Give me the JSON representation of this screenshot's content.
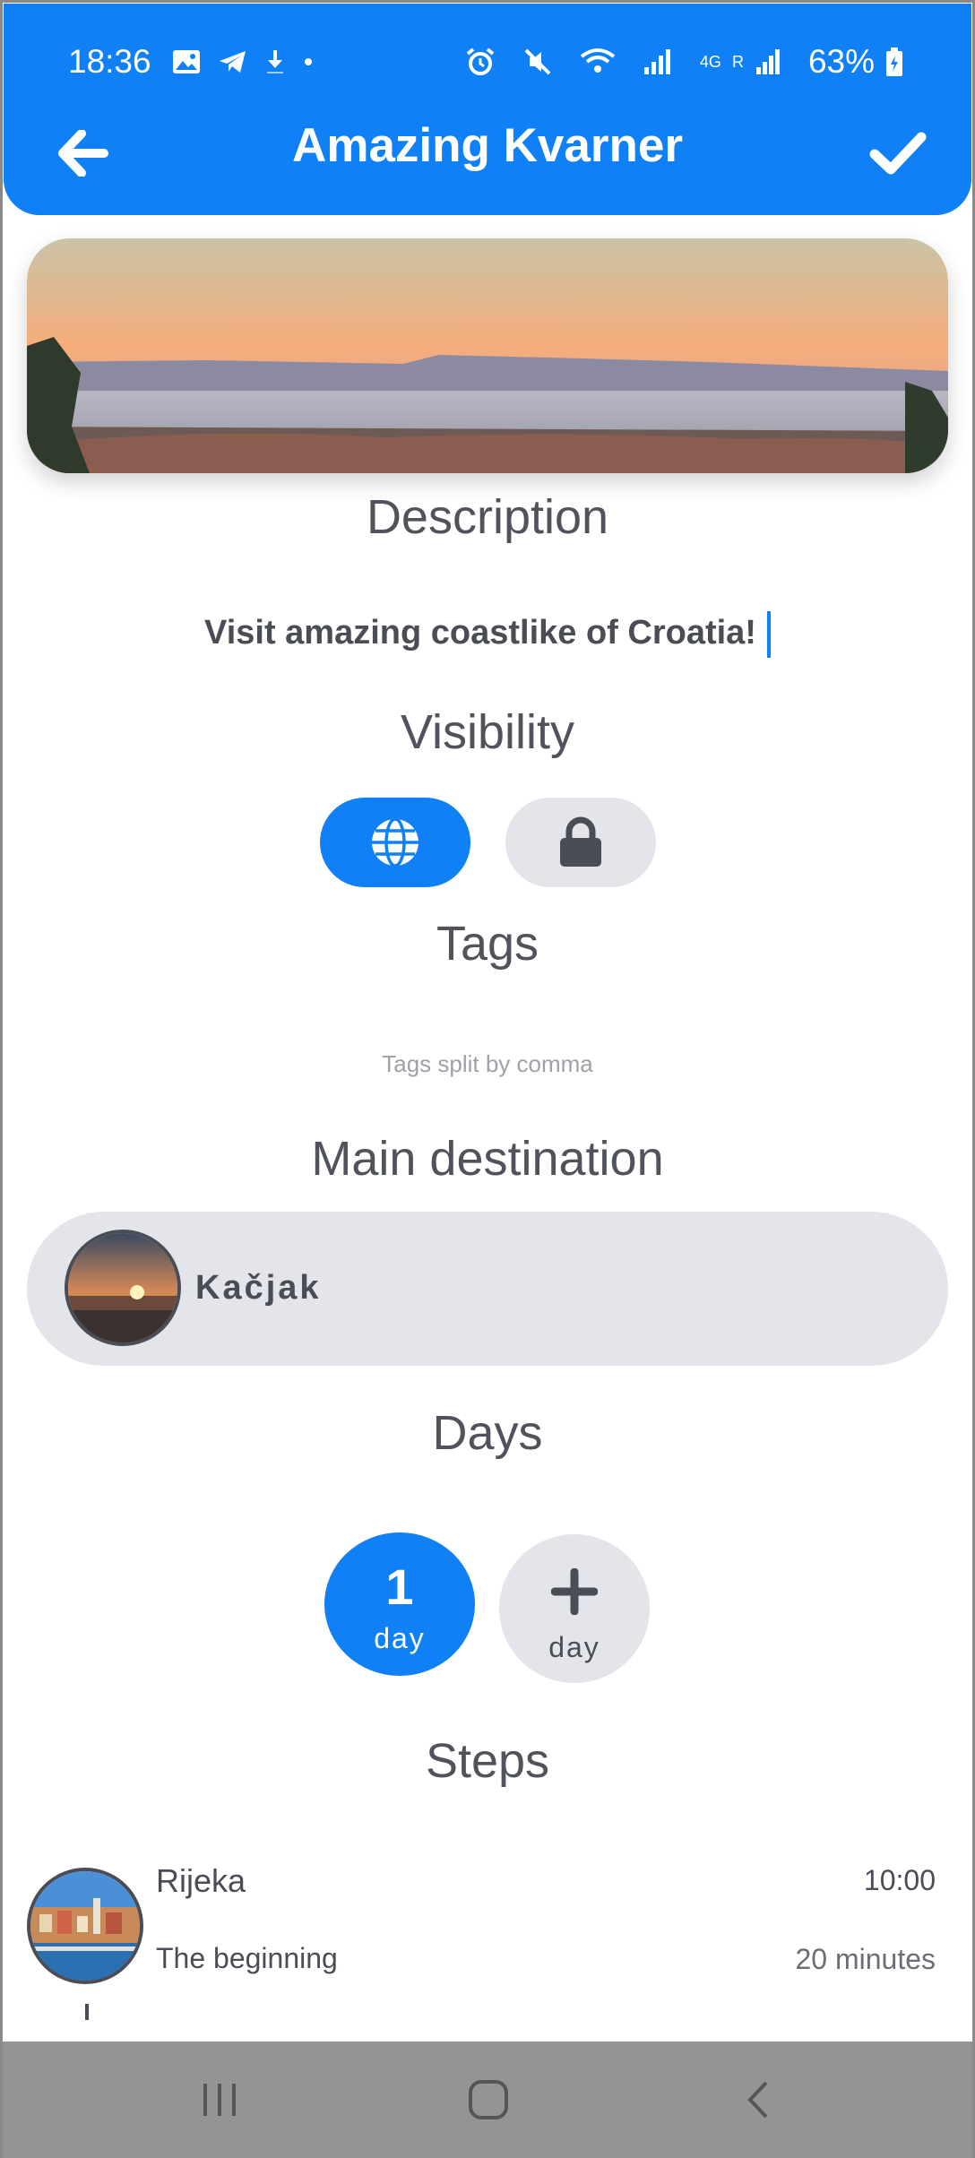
{
  "status_bar": {
    "time": "18:36",
    "network_4g": "4G",
    "network_r": "R",
    "battery": "63%",
    "icons": [
      "gallery-icon",
      "telegram-icon",
      "download-icon",
      "dot-icon",
      "alarm-icon",
      "mute-icon",
      "wifi-icon",
      "signal-icon",
      "battery-icon"
    ]
  },
  "header": {
    "title": "Amazing Kvarner",
    "back_icon": "arrow-left-icon",
    "confirm_icon": "checkmark-icon"
  },
  "description": {
    "title": "Description",
    "text": "Visit amazing coastlike of Croatia!"
  },
  "visibility": {
    "title": "Visibility",
    "options": [
      {
        "icon": "globe-icon",
        "selected": true
      },
      {
        "icon": "lock-icon",
        "selected": false
      }
    ]
  },
  "tags": {
    "title": "Tags",
    "placeholder": "Tags split by comma"
  },
  "main_destination": {
    "title": "Main destination",
    "name": "Kačjak"
  },
  "days": {
    "title": "Days",
    "items": [
      {
        "number": "1",
        "label": "day",
        "selected": true
      }
    ],
    "add": {
      "label": "day",
      "icon": "plus-icon"
    }
  },
  "steps": {
    "title": "Steps",
    "items": [
      {
        "name": "Rijeka",
        "description": "The beginning",
        "time": "10:00",
        "duration": "20 minutes"
      }
    ]
  },
  "colors": {
    "accent": "#0f80f5",
    "pill_gray": "#e4e5ea",
    "text": "#4a4d55"
  }
}
